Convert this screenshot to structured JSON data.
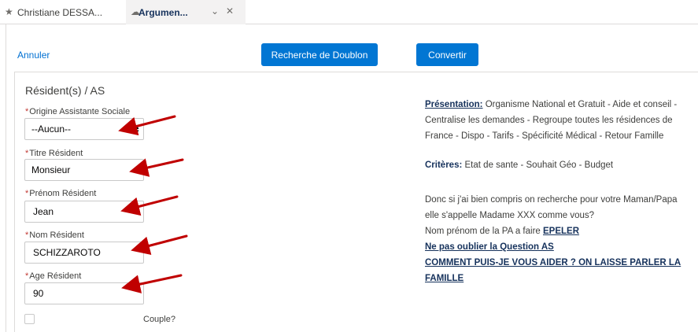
{
  "tabs": [
    {
      "label": "Christiane DESSA...",
      "icon": "star-icon"
    },
    {
      "label": "Argumen...",
      "icon": "cloud-icon",
      "active": true
    }
  ],
  "actions": {
    "cancel_label": "Annuler",
    "duplicate_label": "Recherche de Doublon",
    "convert_label": "Convertir"
  },
  "form": {
    "section_title": "Résident(s) / AS",
    "fields": {
      "origine": {
        "label": "Origine Assistante Sociale",
        "value": "--Aucun--"
      },
      "titre": {
        "label": "Titre Résident",
        "value": "Monsieur"
      },
      "prenom": {
        "label": "Prénom Résident",
        "value": "Jean"
      },
      "nom": {
        "label": "Nom Résident",
        "value": "SCHIZZAROTO"
      },
      "age": {
        "label": "Age Résident",
        "value": "90"
      }
    },
    "couple_label": "Couple?",
    "required_mark": "*"
  },
  "script_text": {
    "presentation_label": "Présentation:",
    "presentation_line1": "Organisme National et Gratuit - Aide et conseil -",
    "presentation_line2": "Centralise les demandes - Regroupe toutes les résidences de",
    "presentation_line3": "France - Dispo - Tarifs - Spécificité Médical - Retour Famille",
    "criteres_label": "Critères:",
    "criteres_text": "Etat de sante - Souhait Géo - Budget",
    "question_line1": "Donc si j'ai bien compris on recherche pour votre Maman/Papa",
    "question_line2": "elle s'appelle Madame XXX comme vous?",
    "nom_prefix": "Nom prénom de la PA a faire",
    "epeler": "EPELER",
    "as_reminder": "Ne pas oublier la Question AS",
    "comment_line1": "COMMENT PUIS-JE VOUS AIDER ? ON LAISSE PARLER LA",
    "comment_line2": "FAMILLE"
  },
  "colors": {
    "brand_button": "#0176d3",
    "link": "#0070d2",
    "required": "#c23934",
    "annotation_arrow": "#c00000"
  }
}
